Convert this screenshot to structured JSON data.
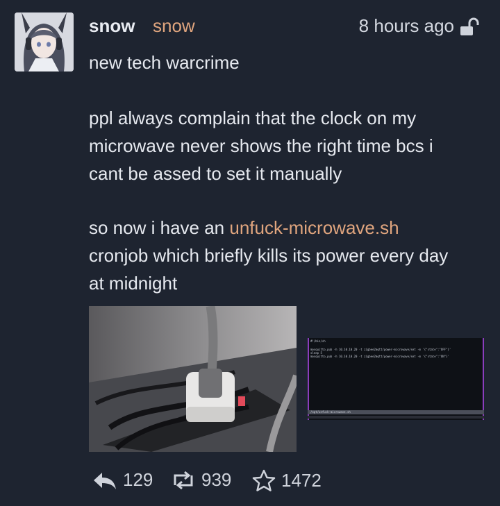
{
  "post": {
    "display_name": "snow",
    "handle": "snow",
    "timestamp": "8 hours ago",
    "paragraphs": {
      "p1": "new tech warcrime",
      "p2_line1": "ppl always complain that the clock on my",
      "p2_line2": "microwave never shows the right time bcs i",
      "p2_line3": "cant be assed to set it manually",
      "p3_line1_prefix": "so now i have an ",
      "p3_link": "unfuck-microwave.sh",
      "p3_line2": "cronjob which briefly kills its power every day",
      "p3_line3": "at midnight"
    }
  },
  "terminal": {
    "line0": "#!/bin/sh",
    "line1": "mosquitto_pub -h 10.10.10.20 -t zigbee2mqtt/power-microwave/set -m '{\"state\":\"OFF\"}'",
    "line2": "sleep 5",
    "line3": "mosquitto_pub -h 10.10.10.20 -t zigbee2mqtt/power-microwave/set -m '{\"state\":\"ON\"}'",
    "status": "/opt/unfuck-microwave.sh"
  },
  "actions": {
    "replies": "129",
    "boosts": "939",
    "favourites": "1472"
  },
  "icons": [
    "avatar",
    "unlocked-icon",
    "reply-icon",
    "boost-icon",
    "star-icon"
  ],
  "colors": {
    "background": "#1e2430",
    "accent": "#e0a57e"
  }
}
